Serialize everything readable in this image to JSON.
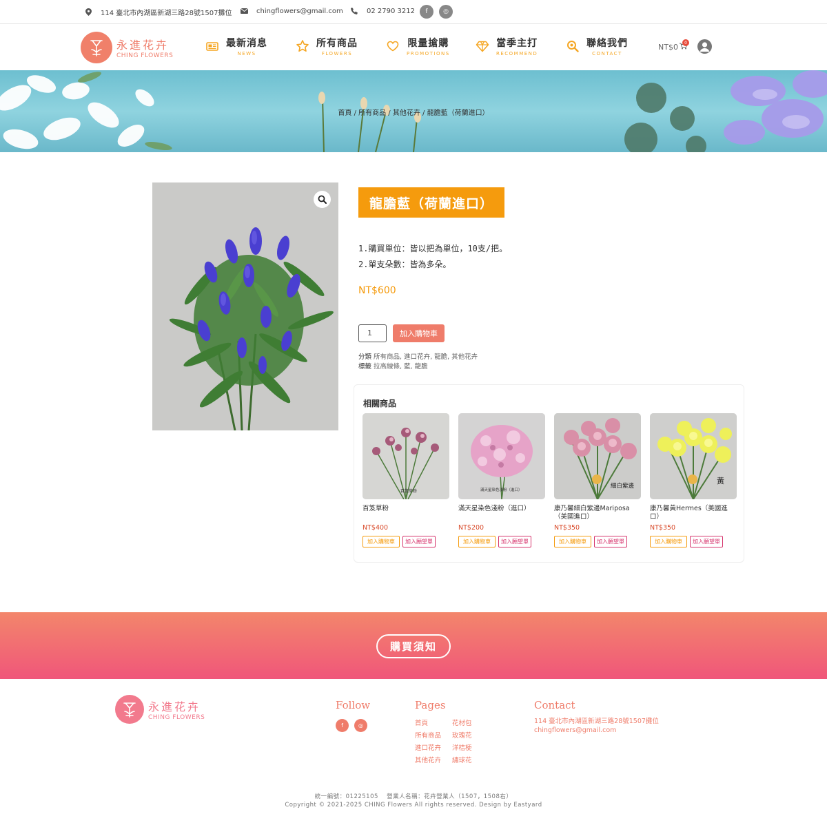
{
  "topbar": {
    "address": "114 臺北市內湖區新湖三路28號1507攤位",
    "email": "chingflowers@gmail.com",
    "phone": "02 2790 3212",
    "social_facebook": "f",
    "social_instagram": "◎"
  },
  "brand": {
    "name_cn": "永進花卉",
    "name_en": "CHING FLOWERS"
  },
  "nav": [
    {
      "label": "最新消息",
      "sub": "NEWS",
      "icon": "newspaper-icon"
    },
    {
      "label": "所有商品",
      "sub": "FLOWERS",
      "icon": "star-icon"
    },
    {
      "label": "限量搶購",
      "sub": "PROMOTIONS",
      "icon": "heart-icon"
    },
    {
      "label": "當季主打",
      "sub": "RECOMMEND",
      "icon": "diamond-icon"
    },
    {
      "label": "聯絡我們",
      "sub": "CONTACT",
      "icon": "search-icon"
    }
  ],
  "cart": {
    "total": "NT$0",
    "count": "0"
  },
  "breadcrumb": "首頁 / 所有商品 / 其他花卉 / 龍膽藍（荷蘭進口）",
  "product": {
    "title": "龍膽藍（荷蘭進口）",
    "desc_line1": "1.購買單位：皆以把為單位，10支/把。",
    "desc_line2": "2.單支朵數：皆為多朵。",
    "price": "NT$600",
    "quantity": "1",
    "add_to_cart": "加入購物車",
    "category_label": "分類",
    "categories": "所有商品, 進口花卉, 龍膽, 其他花卉",
    "tag_label": "標籤",
    "tags": "拉高線條, 藍, 龍膽"
  },
  "related": {
    "title": "相關商品",
    "cart_label": "加入購物車",
    "wish_label": "加入願望單",
    "items": [
      {
        "name": "百笈草粉",
        "price": "NT$400",
        "img_caption": "百笈草粉"
      },
      {
        "name": "滿天星染色淺粉（進口）",
        "price": "NT$200",
        "img_caption": "滿天星染色淺粉（進口）"
      },
      {
        "name": "康乃馨細白紫邊Mariposa（美國進口）",
        "price": "NT$350",
        "img_caption": "細白紫邊"
      },
      {
        "name": "康乃馨黃Hermes（美國進口）",
        "price": "NT$350",
        "img_caption": "黃"
      }
    ]
  },
  "notice": {
    "label": "購買須知"
  },
  "footer": {
    "follow_title": "Follow",
    "pages_title": "Pages",
    "contact_title": "Contact",
    "pages_col1": [
      "首頁",
      "所有商品",
      "進口花卉",
      "其他花卉"
    ],
    "pages_col2": [
      "花材包",
      "玫瑰花",
      "洋桔梗",
      "繡球花"
    ],
    "contact_address": "114 臺北市內湖區新湖三路28號1507攤位",
    "contact_email": "chingflowers@gmail.com",
    "legal_line1": "統一編號：01225105　 營業人名稱：花卉營業人（1507，1508右）",
    "legal_line2": "Copyright © 2021-2025 CHING Flowers All rights reserved. Design by Eastyard"
  },
  "colors": {
    "accent_orange": "#f59b0d",
    "accent_coral": "#ef7c6a",
    "accent_pink": "#f0567a"
  }
}
